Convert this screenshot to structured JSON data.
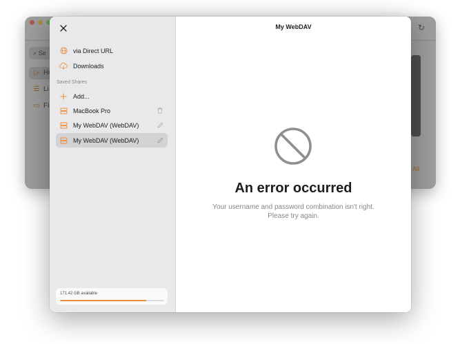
{
  "background_window": {
    "search_placeholder": "Se",
    "sidebar_items": [
      {
        "label": "Ho",
        "icon": "play-icon"
      },
      {
        "label": "Li",
        "icon": "stack-icon"
      },
      {
        "label": "Fi",
        "icon": "folder-icon"
      }
    ],
    "all_label": "All",
    "traffic_colors": [
      "#a65a52",
      "#a88a4a",
      "#5f9a55"
    ]
  },
  "modal": {
    "title": "My WebDAV",
    "sidebar": {
      "top_items": [
        {
          "label": "via Direct URL",
          "icon": "globe-icon"
        },
        {
          "label": "Downloads",
          "icon": "cloud-download-icon"
        }
      ],
      "section_header": "Saved Shares",
      "add_label": "Add...",
      "shares": [
        {
          "label": "MacBook Pro",
          "icon": "drive-icon",
          "trailing_icon": "trash-icon"
        },
        {
          "label": "My WebDAV (WebDAV)",
          "icon": "drive-icon",
          "trailing_icon": "pencil-icon"
        },
        {
          "label": "My WebDAV (WebDAV)",
          "icon": "drive-icon",
          "trailing_icon": "pencil-icon",
          "selected": true
        }
      ],
      "storage": {
        "text": "171.42 GB available",
        "fill_fraction": 0.83
      }
    },
    "error": {
      "icon": "prohibited-icon",
      "title": "An error occurred",
      "message_line1": "Your username and password combination isn't right.",
      "message_line2": "Please try again."
    }
  },
  "colors": {
    "accent": "#ea8d3c",
    "sidebar_bg": "#e9e9eb",
    "selected_row": "#d3d3d6",
    "secondary_text": "#86868b"
  }
}
